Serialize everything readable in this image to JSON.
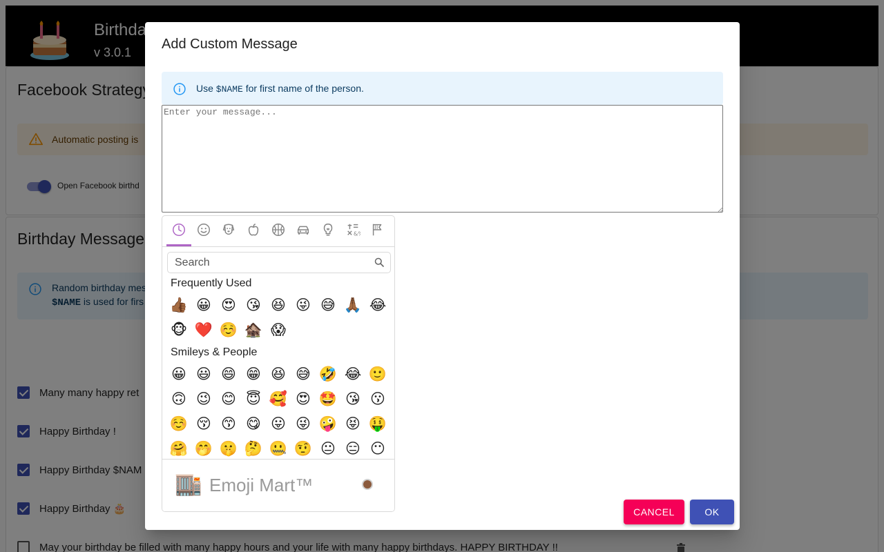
{
  "app": {
    "title": "Birthday Manager",
    "version": "v 3.0.1"
  },
  "facebook_card": {
    "title": "Facebook Strategy",
    "warning": "Automatic posting is",
    "toggle_label": "Open Facebook birthd",
    "toggle_on": true
  },
  "messages_card": {
    "title": "Birthday Messages",
    "info_line1": "Random birthday mes",
    "info_line2_var": "$NAME",
    "info_line2_rest": " is used for firs",
    "rows": [
      {
        "text": "Many many happy ret",
        "checked": true
      },
      {
        "text": "Happy Birthday !",
        "checked": true
      },
      {
        "text": "Happy Birthday $NAM",
        "checked": true
      },
      {
        "text": "Happy Birthday 🎂",
        "checked": true
      },
      {
        "text": "May your birthday be filled with many happy hours and your life with many happy birthdays. HAPPY BIRTHDAY !!",
        "checked": false
      }
    ]
  },
  "dialog": {
    "title": "Add Custom Message",
    "info_prefix": "Use ",
    "info_var": "$NAME",
    "info_suffix": " for first name of the person.",
    "textarea_placeholder": "Enter your message...",
    "cancel_label": "CANCEL",
    "ok_label": "OK",
    "colors": {
      "cancel": "#f50057",
      "ok": "#3f51b5",
      "info_bg": "#e8f4fd",
      "picker_accent": "#ae65c5"
    }
  },
  "emoji_picker": {
    "categories": [
      "clock-icon",
      "smiley-icon",
      "dog-icon",
      "apple-icon",
      "basketball-icon",
      "car-icon",
      "lightbulb-icon",
      "symbols-icon",
      "flag-icon"
    ],
    "active_category": "clock-icon",
    "search_placeholder": "Search",
    "frequently_used_title": "Frequently Used",
    "frequently_used": [
      "👍🏾",
      "😀",
      "😍",
      "😘",
      "😆",
      "😜",
      "😅",
      "🙏🏾",
      "😂",
      "🐵",
      "❤️",
      "☺️",
      "🏚️",
      "😱"
    ],
    "smileys_title": "Smileys & People",
    "smileys": [
      "😀",
      "😃",
      "😄",
      "😁",
      "😆",
      "😅",
      "🤣",
      "😂",
      "🙂",
      "🙃",
      "😉",
      "😊",
      "😇",
      "🥰",
      "😍",
      "🤩",
      "😘",
      "😗",
      "☺️",
      "😚",
      "😙",
      "😋",
      "😛",
      "😜",
      "🤪",
      "😝",
      "🤑",
      "🤗",
      "🤭",
      "🤫",
      "🤔",
      "🤐",
      "🤨",
      "😐",
      "😑",
      "😶"
    ],
    "preview_emoji": "🏬",
    "preview_name": "Emoji Mart™"
  }
}
